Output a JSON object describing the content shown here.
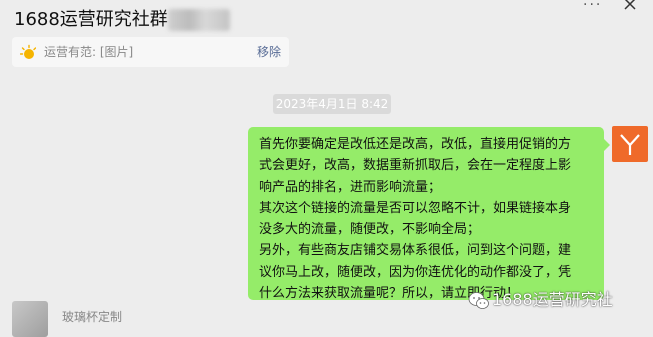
{
  "header": {
    "title": "1688运营研究社群",
    "more_label": "···"
  },
  "pinned": {
    "text": "运营有范: [图片]",
    "remove_label": "移除"
  },
  "timestamp": "2023年4月1日 8:42",
  "message": {
    "lines": [
      "首先你要确定是改低还是改高，改低，直接用促销的方",
      "式会更好，改高，数据重新抓取后，会在一定程度上影",
      "响产品的排名，进而影响流量；",
      "其次这个链接的流量是否可以忽略不计，如果链接本身",
      "没多大的流量，随便改，不影响全局；",
      "另外，有些商友店铺交易体系很低，问到这个问题，建",
      "议你马上改，随便改，因为你连优化的动作都没了，凭",
      "什么方法来获取流量呢？所以，请立即行动！"
    ]
  },
  "incoming": {
    "name": "玻璃杯定制"
  },
  "watermark": {
    "text": "1688运营研究社"
  },
  "colors": {
    "background": "#ededed",
    "bubble": "#95ec69",
    "avatar": "#ef6a2a",
    "link": "#576b95"
  }
}
